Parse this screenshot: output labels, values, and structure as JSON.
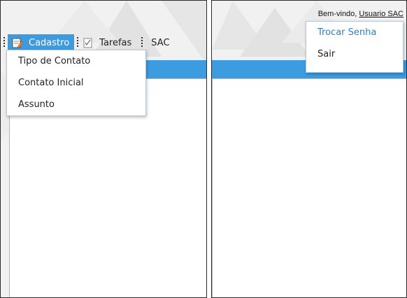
{
  "left": {
    "menubar": {
      "items": [
        {
          "label": "Cadastro",
          "icon": "edit-icon"
        },
        {
          "label": "Tarefas",
          "icon": "checklist-icon"
        },
        {
          "label": "SAC",
          "icon": ""
        }
      ]
    },
    "dropdown": {
      "items": [
        "Tipo de Contato",
        "Contato Inicial",
        "Assunto"
      ]
    }
  },
  "right": {
    "welcome": {
      "prefix": "Bem-vindo,",
      "user": "Usuario SAC"
    },
    "user_menu": {
      "items": [
        "Trocar Senha",
        "Sair"
      ]
    }
  },
  "colors": {
    "accent": "#3d9be0",
    "link": "#2a7fd4"
  }
}
